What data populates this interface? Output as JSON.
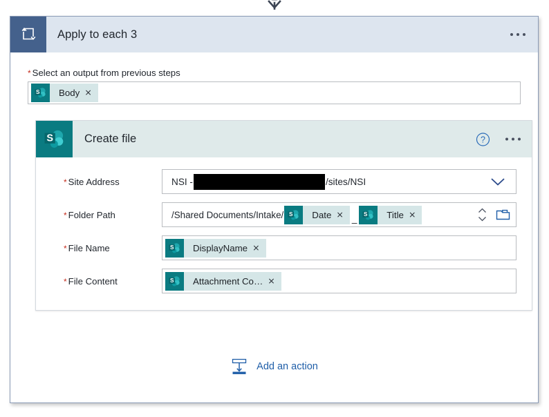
{
  "connector": {
    "icon": "arrow-down-connector"
  },
  "loop_card": {
    "icon": "loop-repeat-icon",
    "title": "Apply to each 3",
    "menu_icon": "ellipsis-icon",
    "output_field": {
      "required_marker": "*",
      "label": "Select an output from previous steps",
      "token": {
        "icon": "sharepoint-icon",
        "label": "Body",
        "remove": "×"
      }
    }
  },
  "action_card": {
    "icon": "sharepoint-icon",
    "title": "Create file",
    "help_icon": "help-question-icon",
    "menu_icon": "ellipsis-icon",
    "fields": [
      {
        "required_marker": "*",
        "label": "Site Address",
        "type": "dropdown",
        "value_prefix": "NSI -",
        "value_suffix": "/sites/NSI",
        "redacted": true,
        "dropdown_icon": "chevron-down-icon"
      },
      {
        "required_marker": "*",
        "label": "Folder Path",
        "type": "token-path",
        "static_text": "/Shared Documents/Intake/",
        "separator": "_",
        "tokens": [
          {
            "icon": "sharepoint-icon",
            "label": "Date",
            "remove": "×"
          },
          {
            "icon": "sharepoint-icon",
            "label": "Title",
            "remove": "×"
          }
        ],
        "stepper_icon": "stepper-up-down-icon",
        "browse_icon": "folder-open-icon"
      },
      {
        "required_marker": "*",
        "label": "File Name",
        "type": "token",
        "tokens": [
          {
            "icon": "sharepoint-icon",
            "label": "DisplayName",
            "remove": "×"
          }
        ]
      },
      {
        "required_marker": "*",
        "label": "File Content",
        "type": "token",
        "tokens": [
          {
            "icon": "sharepoint-icon",
            "label": "Attachment Co…",
            "remove": "×"
          }
        ]
      }
    ]
  },
  "add_action": {
    "icon": "add-action-icon",
    "label": "Add an action"
  },
  "colors": {
    "loop_header_bg": "#dde5ef",
    "loop_icon_bg": "#44618c",
    "sharepoint_teal": "#0a7b81",
    "action_header_bg": "#dfeaea",
    "chip_bg": "#d5e6e7",
    "link_blue": "#1f5ea8",
    "required_red": "#c42b1c",
    "card_border": "#8a9ab5"
  }
}
